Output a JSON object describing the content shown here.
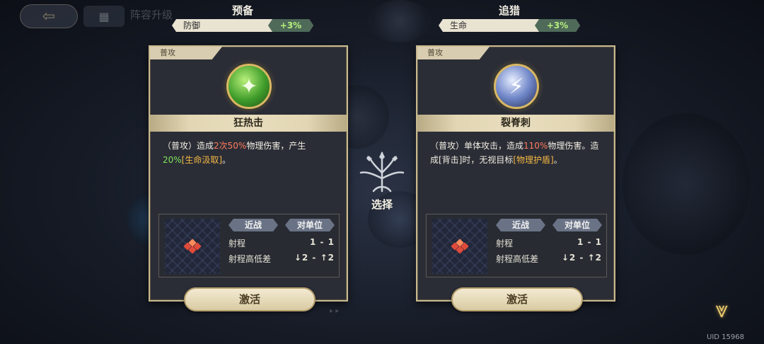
{
  "header": {
    "back_icon": "arrow-left-icon",
    "menu_icon": "grid-icon",
    "dim_title": "阵容升级"
  },
  "banners": [
    {
      "title": "预备",
      "stat": "防御",
      "value": "+3%"
    },
    {
      "title": "追猎",
      "stat": "生命",
      "value": "+3%"
    }
  ],
  "cards": [
    {
      "tag": "普攻",
      "icon": "green-sword-slash-icon",
      "name": "狂热击",
      "desc_parts": [
        "（普攻）造成",
        "2次",
        "50%",
        "物理伤害，产生",
        "20%",
        "[生命汲取]",
        "。"
      ],
      "range": {
        "melee_label": "近战",
        "target_label": "对单位",
        "range_label": "射程",
        "range_value": "1 - 1",
        "height_label": "射程高低差",
        "height_value": "↓2 - ↑2"
      },
      "activate_label": "激活"
    },
    {
      "tag": "普攻",
      "icon": "blue-lightning-pierce-icon",
      "name": "裂脊刺",
      "desc_parts": [
        "（普攻）单体攻击，造成",
        "110%",
        "物理伤害。造成[背击]时，无视目标",
        "[物理护盾]",
        "。"
      ],
      "range": {
        "melee_label": "近战",
        "target_label": "对单位",
        "range_label": "射程",
        "range_value": "1 - 1",
        "height_label": "射程高低差",
        "height_value": "↓2 - ↑2"
      },
      "activate_label": "激活"
    }
  ],
  "center": {
    "choose_label": "选择",
    "emblem_icon": "tree-emblem-icon"
  },
  "footer": {
    "expand_icon": "chevron-down-icon",
    "uid": "UID 15968"
  },
  "colors": {
    "highlight_red": "#ff7c5c",
    "highlight_green": "#7fe55a",
    "highlight_gold": "#f3b844",
    "buff_value": "#b7f07c"
  }
}
